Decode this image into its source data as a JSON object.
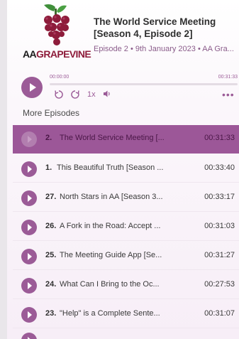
{
  "logo": {
    "text_aa": "AA",
    "text_grapevine": "GRAPEVINE",
    "icon": "grape-cluster-icon",
    "grape_color": "#8e1c3b",
    "leaf_color": "#3f8f3a"
  },
  "episode": {
    "title": "The World Service Meeting [Season 4, Episode 2]",
    "meta": "Episode 2 • 9th January 2023 • AA Gra..."
  },
  "player": {
    "current_time": "00:00:00",
    "total_time": "00:31:33",
    "progress": 0.0,
    "rewind_icon": "rewind-icon",
    "forward_icon": "forward-icon",
    "speed": "1x",
    "volume_icon": "volume-icon",
    "more_icon": "more-dots-icon",
    "accent": "#9b5b97"
  },
  "more_episodes": {
    "heading": "More Episodes",
    "items": [
      {
        "number": "2.",
        "title": "The World Service Meeting [...",
        "duration": "00:31:33",
        "active": true
      },
      {
        "number": "1.",
        "title": "This Beautiful Truth [Season ...",
        "duration": "00:33:40"
      },
      {
        "number": "27.",
        "title": "North Stars in AA [Season 3...",
        "duration": "00:33:17"
      },
      {
        "number": "26.",
        "title": "A Fork in the Road: Accept ...",
        "duration": "00:31:03"
      },
      {
        "number": "25.",
        "title": "The Meeting Guide App [Se...",
        "duration": "00:31:27"
      },
      {
        "number": "24.",
        "title": "What Can I Bring to the Oc...",
        "duration": "00:27:53"
      },
      {
        "number": "23.",
        "title": "\"Help\" is a Complete Sente...",
        "duration": "00:31:07"
      }
    ]
  }
}
